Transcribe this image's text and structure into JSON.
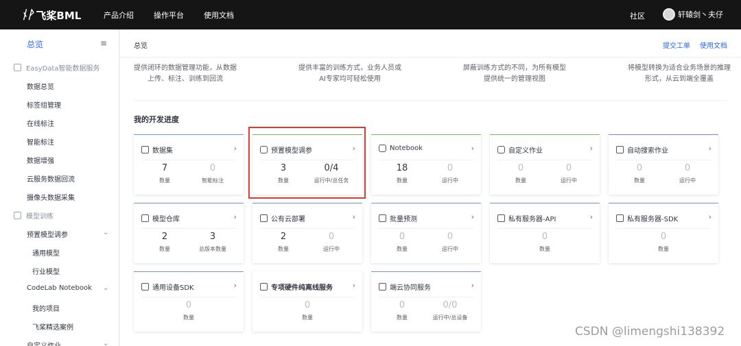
{
  "topbar": {
    "logo_mark": "ᚾᚹ",
    "logo_text": "飞桨BML",
    "nav": [
      "产品介绍",
      "操作平台",
      "使用文档"
    ],
    "community": "社区",
    "user_name": "轩辕剑丶夫仔"
  },
  "sidebar": {
    "title": "总览",
    "collapse_icon": "≡",
    "groups": {
      "easydata": "EasyData智能数据服务",
      "training": "模型训练"
    },
    "items": {
      "data_overview": "数据总览",
      "label_group": "标签组管理",
      "online_label": "在线标注",
      "smart_label": "智能标注",
      "data_aug": "数据增强",
      "cloud_return": "云服务数据回流",
      "camera_collect": "摄像头数据采集",
      "preset_tune": "预置模型调参",
      "general_model": "通用模型",
      "industry_model": "行业模型",
      "codelab": "CodeLab Notebook",
      "my_projects": "我的项目",
      "paddle_cases": "飞桨精选案例",
      "custom_job": "自定义作业"
    }
  },
  "main": {
    "breadcrumb": "总览",
    "links": [
      "提交工单",
      "使用文档"
    ],
    "features": [
      "提供闭环的数据管理功能，从数据\n上传、标注、训练到回流",
      "提供丰富的训练方式，业务人员或\nAI专家均可轻松使用",
      "屏蔽训练方式的不同，为所有模型\n提供统一的管理视图",
      "将模型转换为适合业务场景的推理\n形式，从云到端全覆盖"
    ],
    "section_title": "我的开发进度",
    "cards": [
      {
        "title": "数据集",
        "stats": [
          {
            "v": "7",
            "l": "数量"
          },
          {
            "v": "0",
            "l": "智能标注"
          }
        ]
      },
      {
        "title": "预置模型调参",
        "stats": [
          {
            "v": "3",
            "l": "数量"
          },
          {
            "v": "0/4",
            "l": "运行中/总任务"
          }
        ]
      },
      {
        "title": "Notebook",
        "stats": [
          {
            "v": "18",
            "l": "数量"
          },
          {
            "v": "0",
            "l": "运行中"
          }
        ]
      },
      {
        "title": "自定义作业",
        "stats": [
          {
            "v": "0",
            "l": "数量"
          },
          {
            "v": "0",
            "l": "运行中"
          }
        ]
      },
      {
        "title": "自动搜索作业",
        "stats": [
          {
            "v": "0",
            "l": "数量"
          },
          {
            "v": "0",
            "l": "运行中"
          }
        ]
      },
      {
        "title": "模型仓库",
        "stats": [
          {
            "v": "2",
            "l": "数量"
          },
          {
            "v": "3",
            "l": "总版本数量"
          }
        ]
      },
      {
        "title": "公有云部署",
        "stats": [
          {
            "v": "2",
            "l": "数量"
          },
          {
            "v": "0",
            "l": "运行中"
          }
        ]
      },
      {
        "title": "批量预测",
        "stats": [
          {
            "v": "0",
            "l": "数量"
          },
          {
            "v": "0",
            "l": "运行中"
          }
        ]
      },
      {
        "title": "私有服务器-API",
        "stats": [
          {
            "v": "0",
            "l": "数量"
          }
        ]
      },
      {
        "title": "私有服务器-SDK",
        "stats": [
          {
            "v": "0",
            "l": "数量"
          }
        ]
      },
      {
        "title": "通用设备SDK",
        "stats": [
          {
            "v": "0",
            "l": "数量"
          }
        ]
      },
      {
        "title": "专项硬件纯离线服务",
        "stats": [
          {
            "v": "0",
            "l": "数量"
          }
        ]
      },
      {
        "title": "端云协同服务",
        "stats": [
          {
            "v": "0",
            "l": "数量"
          },
          {
            "v": "0/0",
            "l": "运行中/总设备"
          }
        ]
      }
    ]
  },
  "watermark": "CSDN @limengshi138392",
  "colors": {
    "accent": "#2468f2",
    "highlight": "#e03a2f",
    "topbar": "#151515"
  }
}
